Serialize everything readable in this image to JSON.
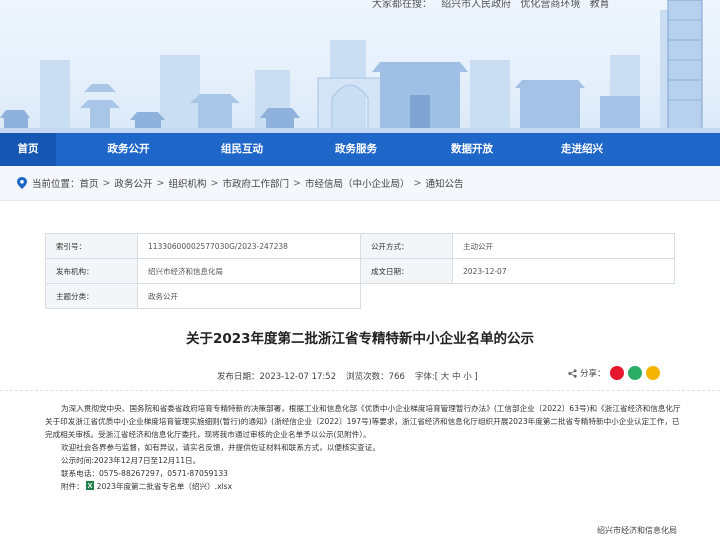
{
  "header": {
    "top_text": [
      "大家都在搜：",
      "绍兴市人民政府",
      "优化营商环境",
      "教育"
    ]
  },
  "nav": {
    "items": [
      "首页",
      "政务公开",
      "组民互动",
      "政务服务",
      "数据开放",
      "走进绍兴"
    ],
    "active": "首页"
  },
  "breadcrumb": {
    "prefix": "当前位置：",
    "items": [
      "首页",
      "政务公开",
      "组织机构",
      "市政府工作部门",
      "市经信局（中小企业局）",
      "通知公告"
    ]
  },
  "meta": {
    "index_label": "索引号：",
    "index_value": "11330600002577030G/2023-247238",
    "open_mode_label": "公开方式：",
    "open_mode_value": "主动公开",
    "issuer_label": "发布机构：",
    "issuer_value": "绍兴市经济和信息化局",
    "date_label": "成文日期：",
    "date_value": "2023-12-07",
    "topic_label": "主题分类：",
    "topic_value": "政务公开"
  },
  "article": {
    "title": "关于2023年度第二批浙江省专精特新中小企业名单的公示",
    "publish_label": "发布日期：",
    "publish_value": "2023-12-07 17:52",
    "views_label": "浏览次数：",
    "views_value": "766",
    "font_label": "字体:[",
    "font_large": "大",
    "font_medium": "中",
    "font_small": "小",
    "font_end": "]",
    "share_label": "分享：",
    "para1": "为深入贯彻党中央、国务院和省委省政府培育专精特新的决策部署，根据工业和信息化部《优质中小企业梯度培育管理暂行办法》(工信部企业〔2022〕63号)和《浙江省经济和信息化厅关于印发浙江省优质中小企业梯度培育管理实施细则(暂行)的通知》(浙经信企业〔2022〕197号)等要求，浙江省经济和信息化厅组织开展2023年度第二批省专精特新中小企业认定工作，已完成相关审核。受浙江省经济和信息化厅委托，现将我市通过审核的企业名单予以公示(见附件）。",
    "para2": "欢迎社会各界参与监督，如有异议，请实名反馈，并提供佐证材料和联系方式，以便核实查证。",
    "para3": "公示时间:2023年12月7日至12月11日。",
    "para4": "联系电话：0575-88267297，0571-87059133",
    "attach_label": "附件：",
    "attach_name": "2023年度第二批省专名单（绍兴）.xlsx",
    "signature": "绍兴市经济和信息化局"
  },
  "colors": {
    "nav_bg": "#1f66c9",
    "nav_active": "#1657b3",
    "weibo": "#e6162d",
    "wechat": "#2aae67",
    "qzone": "#f5b400"
  }
}
